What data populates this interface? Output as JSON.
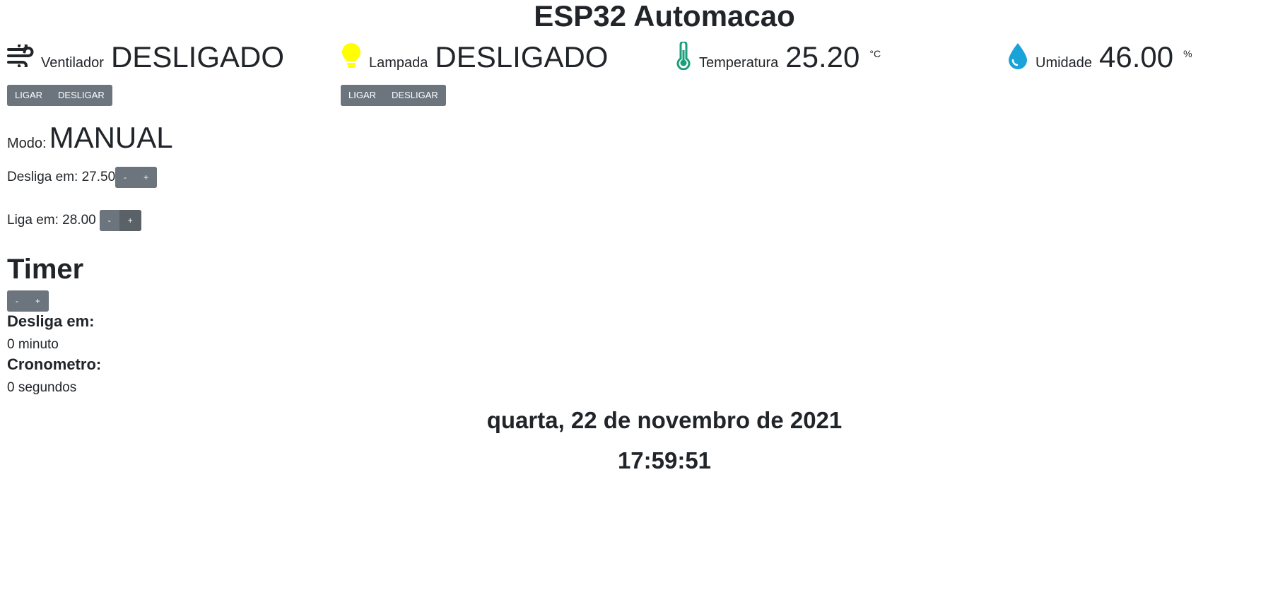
{
  "header": {
    "title": "ESP32 Automacao"
  },
  "stats": {
    "fan": {
      "label": "Ventilador",
      "value": "DESLIGADO",
      "icon": "wind-icon"
    },
    "lamp": {
      "label": "Lampada",
      "value": "DESLIGADO",
      "icon": "lightbulb-icon",
      "icon_color": "#ffff00"
    },
    "temperature": {
      "label": "Temperatura",
      "value": "25.20",
      "unit": "°C",
      "icon": "thermometer-icon",
      "icon_color": "#1a9e7c"
    },
    "humidity": {
      "label": "Umidade",
      "value": "46.00",
      "unit": "%",
      "icon": "droplet-icon",
      "icon_color": "#1aa3d9"
    }
  },
  "fan_controls": {
    "on_label": "LIGAR",
    "off_label": "DESLIGAR"
  },
  "lamp_controls": {
    "on_label": "LIGAR",
    "off_label": "DESLIGAR"
  },
  "mode": {
    "label": "Modo:",
    "value": "MANUAL"
  },
  "thresholds": {
    "off_at": {
      "label": "Desliga em: 27.50",
      "minus": "-",
      "plus": "+"
    },
    "on_at": {
      "label": "Liga em: 28.00",
      "minus": "-",
      "plus": "+"
    }
  },
  "timer": {
    "title": "Timer",
    "minus": "-",
    "plus": "+",
    "off_label": "Desliga em:",
    "off_value": "0 minuto",
    "stopwatch_label": "Cronometro:",
    "stopwatch_value": "0 segundos"
  },
  "clock": {
    "date": "quarta, 22 de novembro de 2021",
    "time": "17:59:51"
  },
  "colors": {
    "button_bg": "#6c757d",
    "text": "#212529"
  }
}
